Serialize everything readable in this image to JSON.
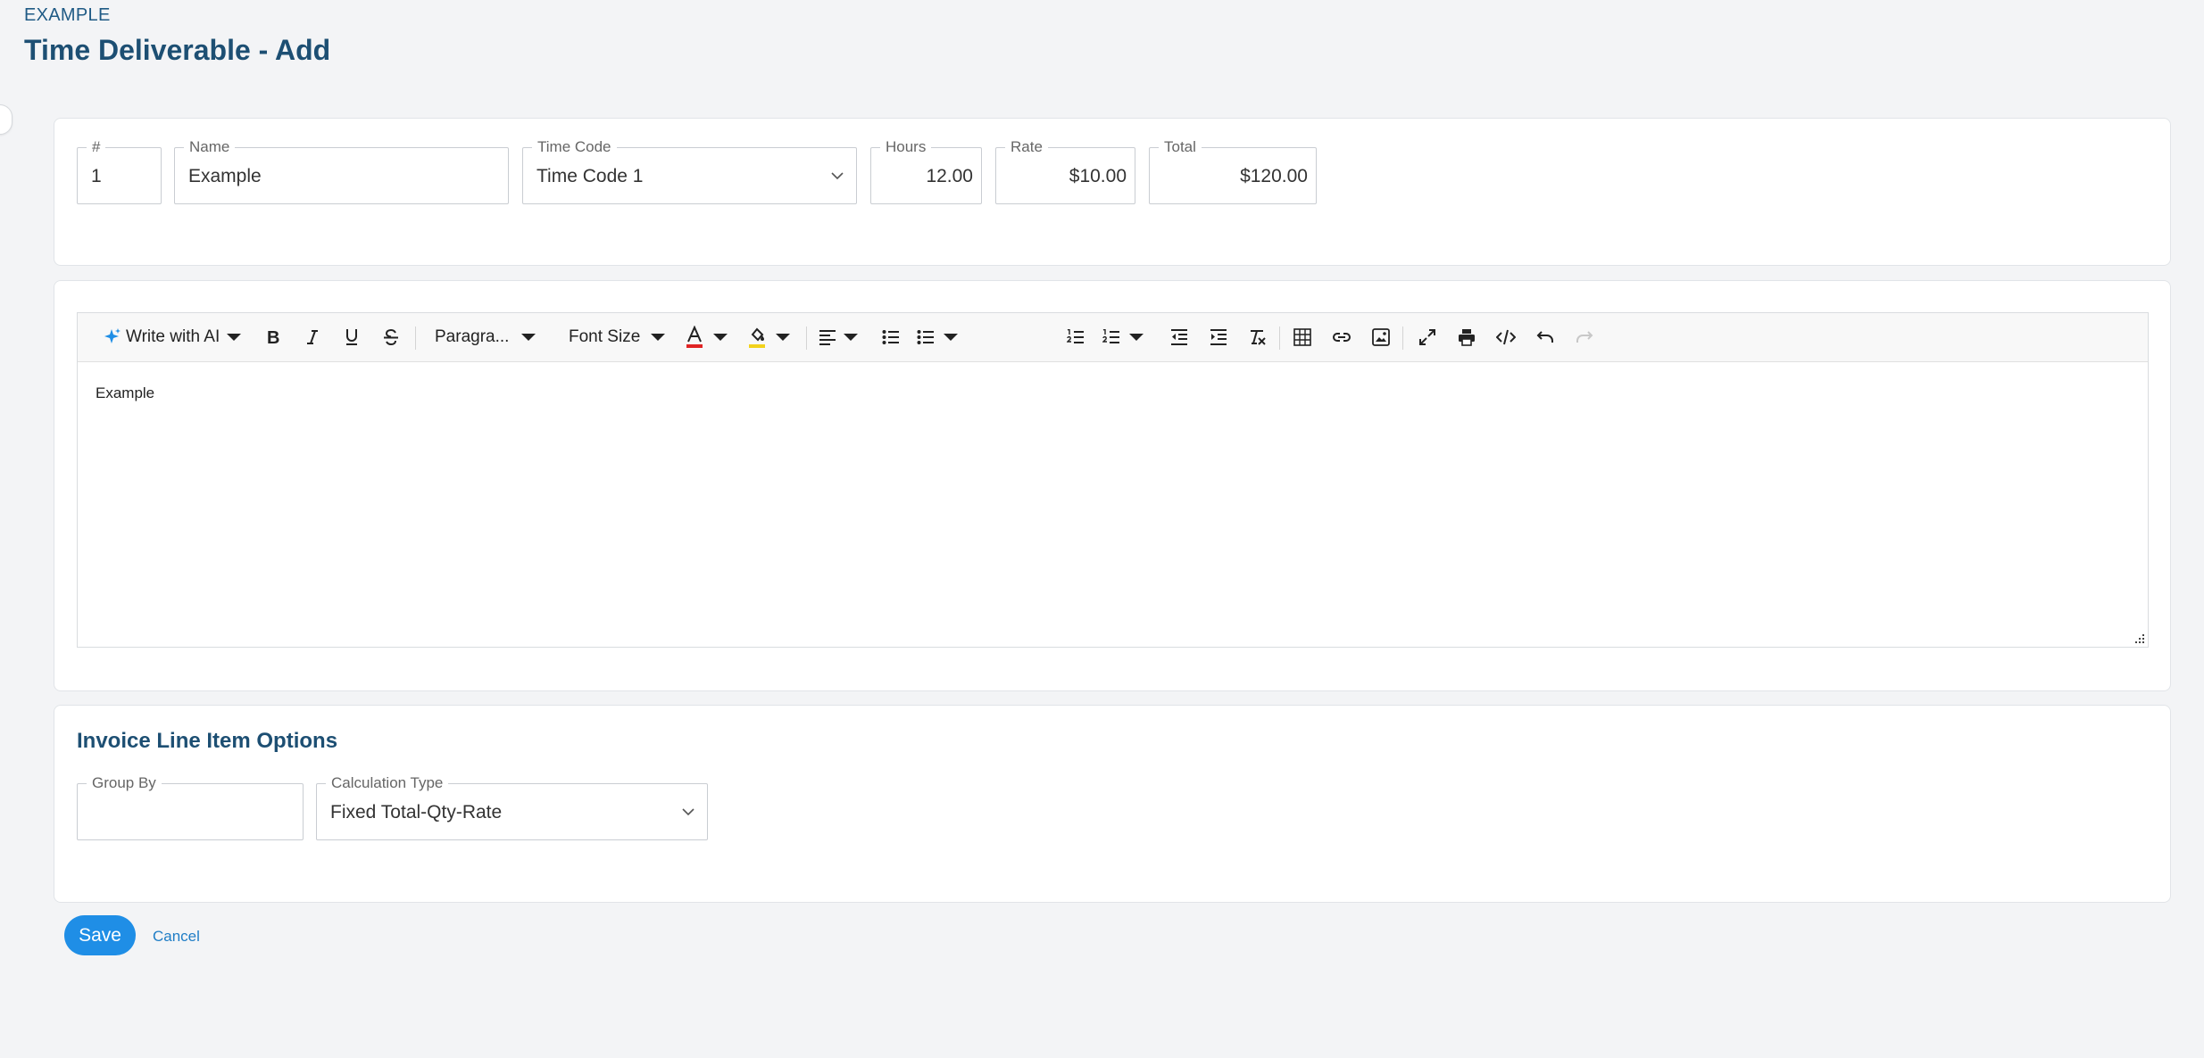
{
  "breadcrumb": "EXAMPLE",
  "title": "Time Deliverable - Add",
  "fields": {
    "number": {
      "label": "#",
      "value": "1"
    },
    "name": {
      "label": "Name",
      "value": "Example"
    },
    "time_code": {
      "label": "Time Code",
      "value": "Time Code 1"
    },
    "hours": {
      "label": "Hours",
      "value": "12.00"
    },
    "rate": {
      "label": "Rate",
      "value": "$10.00"
    },
    "total": {
      "label": "Total",
      "value": "$120.00"
    }
  },
  "toolbar": {
    "ai_label": "Write with AI",
    "paragraph_label": "Paragra...",
    "font_size_label": "Font Size",
    "icons": [
      "sparkle-icon",
      "bold-icon",
      "italic-icon",
      "underline-icon",
      "strikethrough-icon",
      "text-color-icon",
      "highlight-icon",
      "align-icon",
      "bullet-list-icon",
      "numbered-list-icon",
      "outdent-icon",
      "indent-icon",
      "clear-format-icon",
      "table-icon",
      "link-icon",
      "image-icon",
      "fullscreen-icon",
      "print-icon",
      "code-icon",
      "undo-icon",
      "redo-icon"
    ],
    "text_color": "#e02424",
    "highlight_color": "#f2d21b",
    "ai_icon_color": "#1f8ee6"
  },
  "editor": {
    "content": "Example"
  },
  "invoice_options": {
    "title": "Invoice Line Item Options",
    "group_by": {
      "label": "Group By",
      "value": ""
    },
    "calculation_type": {
      "label": "Calculation Type",
      "value": "Fixed Total-Qty-Rate"
    }
  },
  "actions": {
    "save": "Save",
    "cancel": "Cancel"
  },
  "colors": {
    "accent": "#1f8ee6",
    "heading": "#1d4f73",
    "background": "#f3f4f6"
  }
}
